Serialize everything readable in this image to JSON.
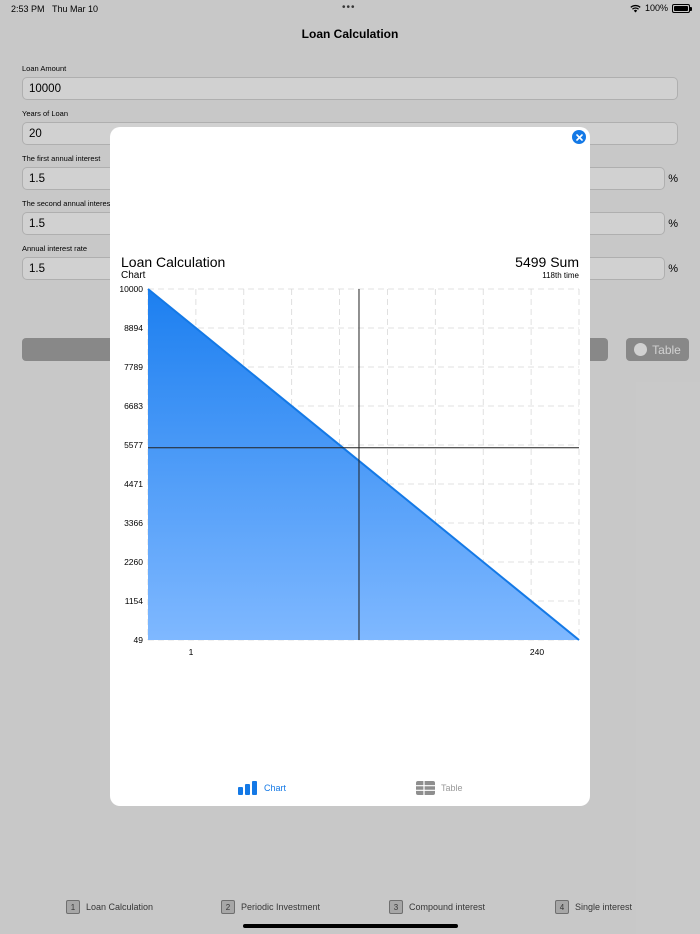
{
  "status": {
    "time": "2:53 PM",
    "date": "Thu Mar 10",
    "battery": "100%"
  },
  "nav": {
    "title": "Loan Calculation"
  },
  "form": {
    "fields": [
      {
        "label": "Loan Amount",
        "value": "10000",
        "suffix": ""
      },
      {
        "label": "Years of Loan",
        "value": "20",
        "suffix": ""
      },
      {
        "label": "The first annual interest",
        "value": "1.5",
        "suffix": "%"
      },
      {
        "label": "The second annual interest",
        "value": "1.5",
        "suffix": "%"
      },
      {
        "label": "Annual interest rate",
        "value": "1.5",
        "suffix": "%"
      }
    ],
    "table_button": "Table"
  },
  "tabbar": {
    "items": [
      {
        "num": "1",
        "label": "Loan Calculation"
      },
      {
        "num": "2",
        "label": "Periodic Investment"
      },
      {
        "num": "3",
        "label": "Compound interest"
      },
      {
        "num": "4",
        "label": "Single interest"
      }
    ]
  },
  "modal": {
    "title": "Loan Calculation",
    "subtitle": "Chart",
    "sum_text": "5499 Sum",
    "time_text": "118th time",
    "tabs": {
      "chart": "Chart",
      "table": "Table"
    }
  },
  "colors": {
    "accent": "#1479e6",
    "fill_top": "#1c7ff0",
    "fill_bottom": "#7fb8ff"
  },
  "chart_data": {
    "type": "area",
    "x": [
      1,
      240
    ],
    "values": [
      10000,
      49
    ],
    "xticks": [
      "1",
      "240"
    ],
    "yticks": [
      "10000",
      "8894",
      "7789",
      "6683",
      "5577",
      "4471",
      "3366",
      "2260",
      "1154",
      "49"
    ],
    "ylim": [
      49,
      10000
    ],
    "xlim": [
      1,
      240
    ],
    "crosshair": {
      "x": 118,
      "y": 5499
    },
    "grid": true
  }
}
